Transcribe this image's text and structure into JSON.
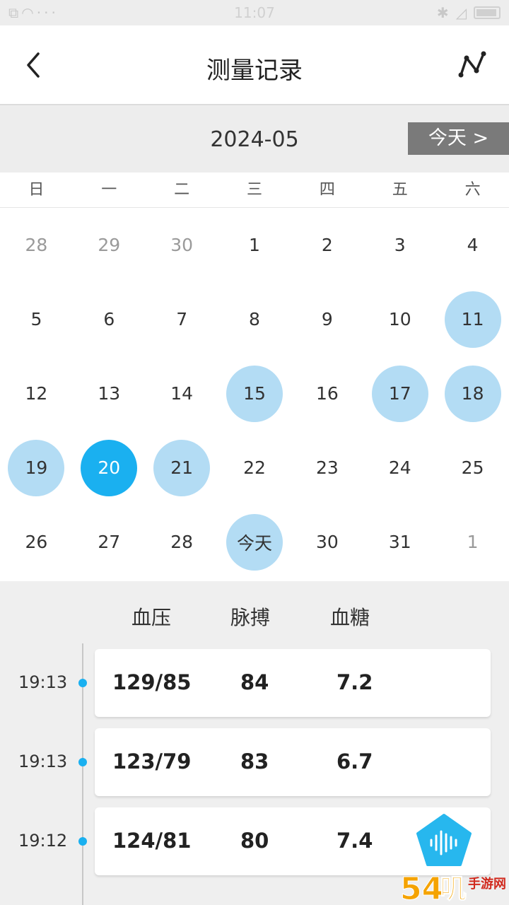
{
  "status_bar": {
    "time": "11:07",
    "left_icons": [
      "copy-icon",
      "wifi-icon",
      "more-icon"
    ],
    "right_icons": [
      "bluetooth-icon",
      "signal-icon",
      "battery-icon"
    ]
  },
  "navbar": {
    "title": "测量记录",
    "back_icon": "chevron-left-icon",
    "trend_icon": "trend-icon"
  },
  "month_bar": {
    "month": "2024-05",
    "today_button": "今天 >"
  },
  "weekdays": [
    "日",
    "一",
    "二",
    "三",
    "四",
    "五",
    "六"
  ],
  "calendar": {
    "weeks": [
      [
        {
          "label": "28",
          "state": "other"
        },
        {
          "label": "29",
          "state": "other"
        },
        {
          "label": "30",
          "state": "other"
        },
        {
          "label": "1",
          "state": "normal"
        },
        {
          "label": "2",
          "state": "normal"
        },
        {
          "label": "3",
          "state": "normal"
        },
        {
          "label": "4",
          "state": "normal"
        }
      ],
      [
        {
          "label": "5",
          "state": "normal"
        },
        {
          "label": "6",
          "state": "normal"
        },
        {
          "label": "7",
          "state": "normal"
        },
        {
          "label": "8",
          "state": "normal"
        },
        {
          "label": "9",
          "state": "normal"
        },
        {
          "label": "10",
          "state": "normal"
        },
        {
          "label": "11",
          "state": "has"
        }
      ],
      [
        {
          "label": "12",
          "state": "normal"
        },
        {
          "label": "13",
          "state": "normal"
        },
        {
          "label": "14",
          "state": "normal"
        },
        {
          "label": "15",
          "state": "has"
        },
        {
          "label": "16",
          "state": "normal"
        },
        {
          "label": "17",
          "state": "has"
        },
        {
          "label": "18",
          "state": "has"
        }
      ],
      [
        {
          "label": "19",
          "state": "has"
        },
        {
          "label": "20",
          "state": "sel"
        },
        {
          "label": "21",
          "state": "has"
        },
        {
          "label": "22",
          "state": "normal"
        },
        {
          "label": "23",
          "state": "normal"
        },
        {
          "label": "24",
          "state": "normal"
        },
        {
          "label": "25",
          "state": "normal"
        }
      ],
      [
        {
          "label": "26",
          "state": "normal"
        },
        {
          "label": "27",
          "state": "normal"
        },
        {
          "label": "28",
          "state": "normal"
        },
        {
          "label": "今天",
          "state": "has"
        },
        {
          "label": "30",
          "state": "normal"
        },
        {
          "label": "31",
          "state": "normal"
        },
        {
          "label": "1",
          "state": "other"
        }
      ]
    ]
  },
  "records": {
    "headers": {
      "blood_pressure": "血压",
      "pulse": "脉搏",
      "blood_sugar": "血糖"
    },
    "rows": [
      {
        "time": "19:13",
        "bp": "129/85",
        "pulse": "84",
        "sugar": "7.2"
      },
      {
        "time": "19:13",
        "bp": "123/79",
        "pulse": "83",
        "sugar": "6.7"
      },
      {
        "time": "19:12",
        "bp": "124/81",
        "pulse": "80",
        "sugar": "7.4"
      }
    ]
  },
  "fab": {
    "icon": "voice-wave-icon"
  },
  "watermark": {
    "text": "54叽手游网",
    "icon": "site-logo-icon"
  },
  "colors": {
    "accent": "#1ab0f0",
    "accent_light": "#b3dcf4",
    "today_button_bg": "#7a7a7a"
  }
}
